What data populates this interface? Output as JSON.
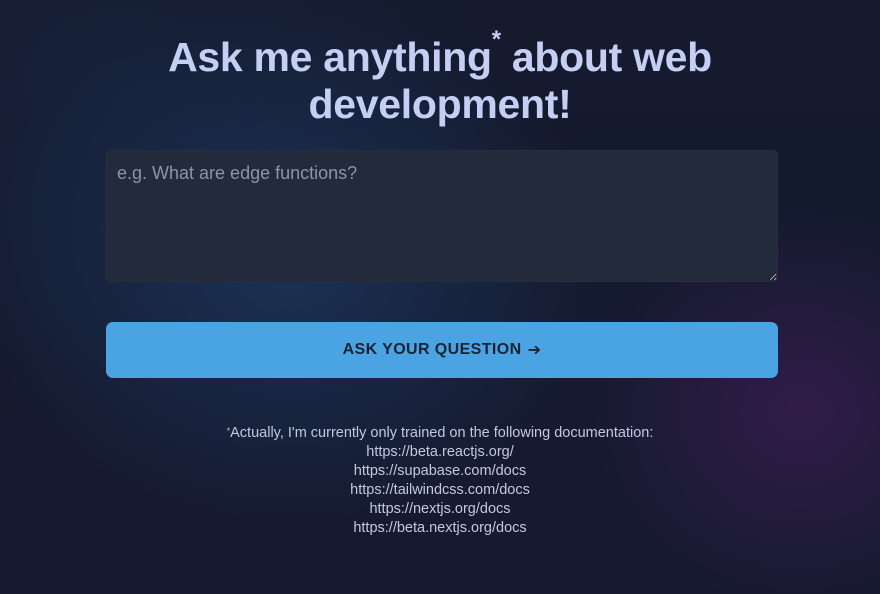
{
  "heading": {
    "line1_pre": "Ask me anything",
    "asterisk": "*",
    "line1_post": " about web",
    "line2": "development!"
  },
  "question_input": {
    "placeholder": "e.g. What are edge functions?",
    "value": ""
  },
  "ask_button": {
    "label": "ASK YOUR QUESTION",
    "icon": "arrow-right-icon",
    "icon_glyph": "➔"
  },
  "footnote": {
    "asterisk": "*",
    "text": "Actually, I'm currently only trained on the following documentation:",
    "links": [
      "https://beta.reactjs.org/",
      "https://supabase.com/docs",
      "https://tailwindcss.com/docs",
      "https://nextjs.org/docs",
      "https://beta.nextjs.org/docs"
    ]
  },
  "colors": {
    "background": "#141a2e",
    "heading": "#c5cff3",
    "input_bg": "#222a3b",
    "button_bg": "#4aa4e3",
    "button_text": "#1a2334",
    "footnote_text": "#c2c9de"
  }
}
